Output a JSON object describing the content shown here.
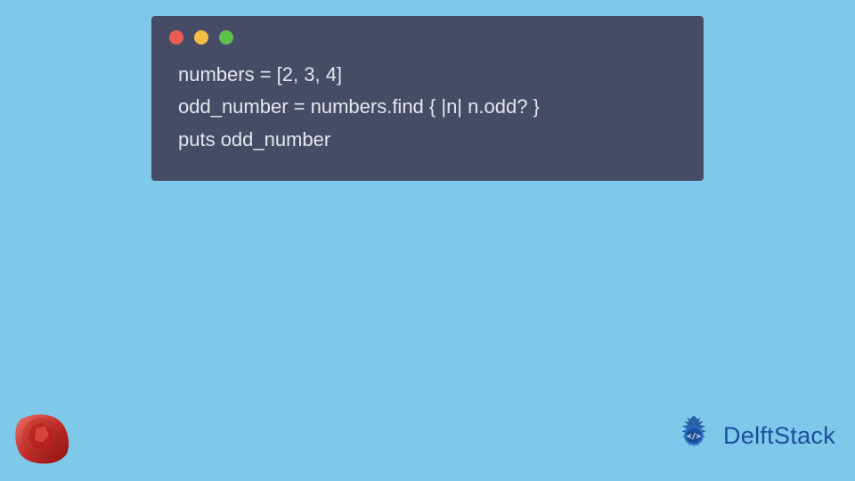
{
  "window": {
    "dots": {
      "red": "#ec5c53",
      "yellow": "#f4bd44",
      "green": "#5bc24b"
    },
    "bg": "#474c66"
  },
  "code": {
    "line1": "numbers = [2, 3, 4]",
    "line2": "odd_number = numbers.find { |n| n.odd? }",
    "line3": "puts odd_number"
  },
  "brand": {
    "name": "DelftStack"
  },
  "colors": {
    "page_bg": "#7ec8ea",
    "brand_text": "#1b4f9c"
  }
}
